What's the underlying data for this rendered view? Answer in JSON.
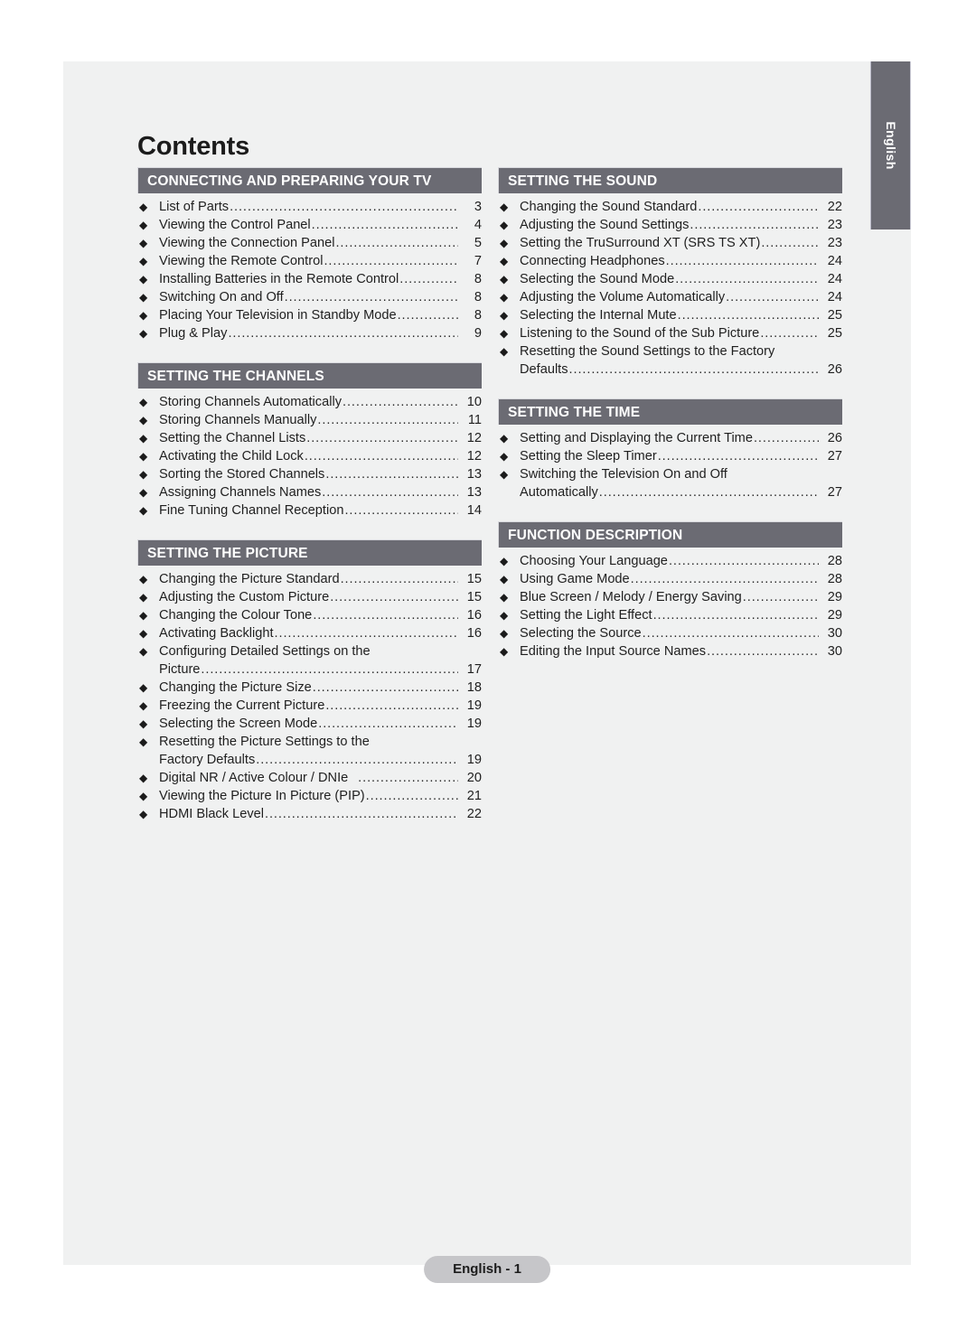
{
  "page": {
    "title": "Contents",
    "side_tab_label": "English",
    "footer_badge": "English - 1",
    "accent_header_color": "#6b6b73",
    "page_background": "#f0f1f1",
    "bullet_glyph": "◆"
  },
  "left_column": {
    "sections": [
      {
        "header": "CONNECTING AND PREPARING YOUR TV",
        "entries": [
          {
            "lines": [
              {
                "text": "List of Parts",
                "page": "3"
              }
            ]
          },
          {
            "lines": [
              {
                "text": "Viewing the Control Panel",
                "page": "4"
              }
            ]
          },
          {
            "lines": [
              {
                "text": "Viewing the Connection Panel",
                "page": "5"
              }
            ]
          },
          {
            "lines": [
              {
                "text": "Viewing the Remote Control",
                "page": "7"
              }
            ]
          },
          {
            "lines": [
              {
                "text": "Installing Batteries in the Remote Control",
                "page": "8"
              }
            ]
          },
          {
            "lines": [
              {
                "text": "Switching On and Off",
                "page": "8"
              }
            ]
          },
          {
            "lines": [
              {
                "text": "Placing Your Television in Standby Mode",
                "page": "8"
              }
            ]
          },
          {
            "lines": [
              {
                "text": "Plug & Play",
                "page": "9"
              }
            ]
          }
        ]
      },
      {
        "header": "SETTING THE CHANNELS",
        "entries": [
          {
            "lines": [
              {
                "text": "Storing Channels Automatically",
                "page": "10"
              }
            ]
          },
          {
            "lines": [
              {
                "text": "Storing Channels Manually",
                "page": "11"
              }
            ]
          },
          {
            "lines": [
              {
                "text": "Setting the Channel Lists",
                "page": "12"
              }
            ]
          },
          {
            "lines": [
              {
                "text": "Activating the Child Lock",
                "page": "12"
              }
            ]
          },
          {
            "lines": [
              {
                "text": "Sorting the Stored Channels",
                "page": "13"
              }
            ]
          },
          {
            "lines": [
              {
                "text": "Assigning Channels Names",
                "page": "13"
              }
            ]
          },
          {
            "lines": [
              {
                "text": "Fine Tuning Channel Reception",
                "page": "14"
              }
            ]
          }
        ]
      },
      {
        "header": "SETTING THE PICTURE",
        "entries": [
          {
            "lines": [
              {
                "text": "Changing the Picture Standard",
                "page": "15"
              }
            ]
          },
          {
            "lines": [
              {
                "text": "Adjusting the Custom Picture",
                "page": "15"
              }
            ]
          },
          {
            "lines": [
              {
                "text": "Changing the Colour Tone",
                "page": "16"
              }
            ]
          },
          {
            "lines": [
              {
                "text": "Activating Backlight",
                "page": "16"
              }
            ]
          },
          {
            "lines": [
              {
                "text": "Configuring Detailed Settings on the",
                "page": "",
                "noleader": true
              },
              {
                "text": "Picture",
                "page": "17"
              }
            ]
          },
          {
            "lines": [
              {
                "text": "Changing the Picture Size",
                "page": "18"
              }
            ]
          },
          {
            "lines": [
              {
                "text": "Freezing the Current Picture",
                "page": "19"
              }
            ]
          },
          {
            "lines": [
              {
                "text": "Selecting the Screen Mode",
                "page": "19"
              }
            ]
          },
          {
            "lines": [
              {
                "text": "Resetting the Picture Settings to the",
                "page": "",
                "noleader": true
              },
              {
                "text": "Factory Defaults",
                "page": "19"
              }
            ]
          },
          {
            "lines": [
              {
                "text": "Digital NR / Active Colour / DNIe",
                "page": "20",
                "gap": true
              }
            ]
          },
          {
            "lines": [
              {
                "text": "Viewing the Picture In Picture (PIP)",
                "page": "21"
              }
            ]
          },
          {
            "lines": [
              {
                "text": "HDMI Black Level",
                "page": "22"
              }
            ]
          }
        ]
      }
    ]
  },
  "right_column": {
    "sections": [
      {
        "header": "SETTING THE SOUND",
        "entries": [
          {
            "lines": [
              {
                "text": "Changing the Sound Standard",
                "page": "22"
              }
            ]
          },
          {
            "lines": [
              {
                "text": "Adjusting the Sound Settings",
                "page": "23"
              }
            ]
          },
          {
            "lines": [
              {
                "text": "Setting the TruSurround XT (SRS TS XT)",
                "page": "23"
              }
            ]
          },
          {
            "lines": [
              {
                "text": "Connecting Headphones",
                "page": "24"
              }
            ]
          },
          {
            "lines": [
              {
                "text": "Selecting the Sound Mode",
                "page": "24"
              }
            ]
          },
          {
            "lines": [
              {
                "text": "Adjusting the Volume Automatically",
                "page": "24"
              }
            ]
          },
          {
            "lines": [
              {
                "text": "Selecting the Internal Mute",
                "page": "25"
              }
            ]
          },
          {
            "lines": [
              {
                "text": "Listening to the Sound of the Sub Picture",
                "page": "25"
              }
            ]
          },
          {
            "lines": [
              {
                "text": "Resetting the Sound Settings to the Factory",
                "page": "",
                "noleader": true
              },
              {
                "text": "Defaults",
                "page": "26"
              }
            ]
          }
        ]
      },
      {
        "header": "SETTING THE TIME",
        "entries": [
          {
            "lines": [
              {
                "text": "Setting and Displaying the Current Time",
                "page": "26"
              }
            ]
          },
          {
            "lines": [
              {
                "text": "Setting the Sleep Timer",
                "page": "27"
              }
            ]
          },
          {
            "lines": [
              {
                "text": "Switching the Television On and Off",
                "page": "",
                "noleader": true
              },
              {
                "text": "Automatically",
                "page": "27"
              }
            ]
          }
        ]
      },
      {
        "header": "FUNCTION DESCRIPTION",
        "entries": [
          {
            "lines": [
              {
                "text": "Choosing Your Language",
                "page": "28"
              }
            ]
          },
          {
            "lines": [
              {
                "text": "Using Game Mode",
                "page": "28"
              }
            ]
          },
          {
            "lines": [
              {
                "text": "Blue Screen / Melody / Energy Saving",
                "page": "29"
              }
            ]
          },
          {
            "lines": [
              {
                "text": "Setting the Light Effect",
                "page": "29"
              }
            ]
          },
          {
            "lines": [
              {
                "text": "Selecting the Source",
                "page": "30"
              }
            ]
          },
          {
            "lines": [
              {
                "text": "Editing the Input Source Names",
                "page": "30"
              }
            ]
          }
        ]
      }
    ]
  }
}
